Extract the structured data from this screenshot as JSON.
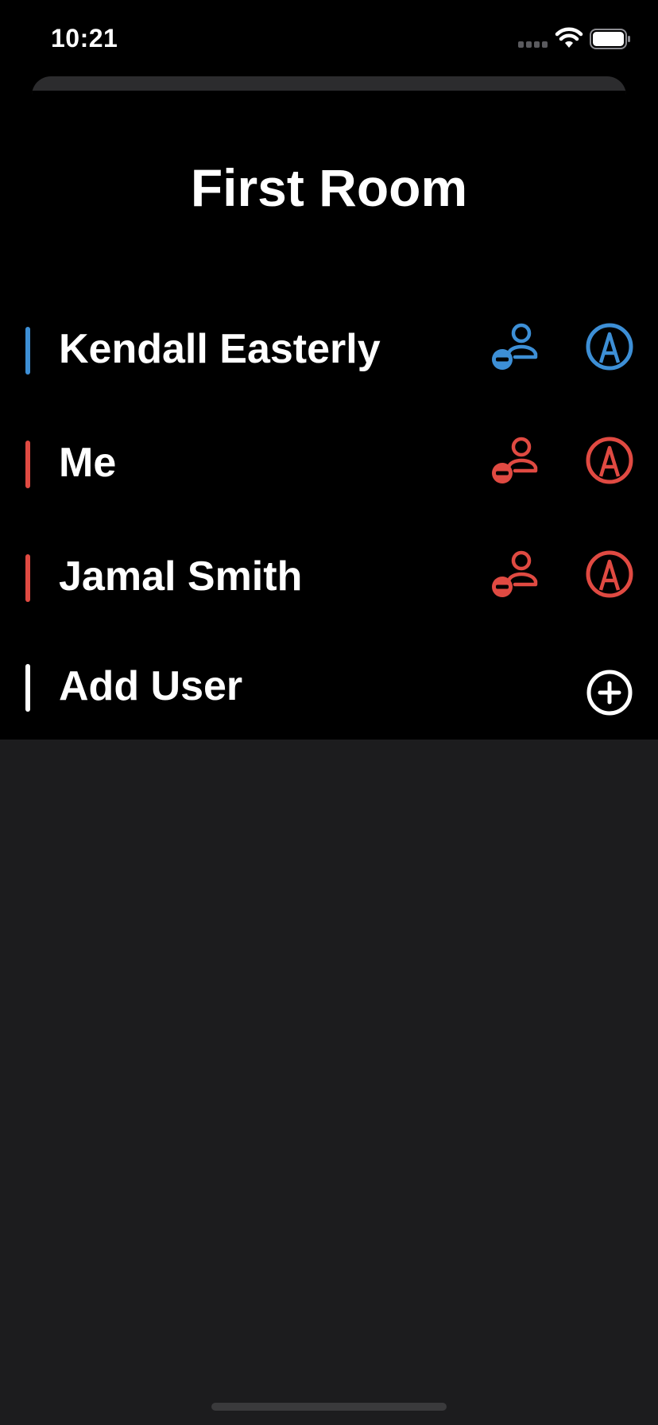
{
  "status_bar": {
    "time": "10:21"
  },
  "page": {
    "title": "First Room"
  },
  "colors": {
    "blue": "#3d8fd6",
    "red": "#e04a42",
    "white": "#ffffff",
    "background": "#000000",
    "lower_background": "#1c1c1e"
  },
  "users": [
    {
      "name": "Kendall Easterly",
      "color": "#3d8fd6",
      "remove_icon": "person-remove-icon",
      "role_icon": "pencil-circle-icon"
    },
    {
      "name": "Me",
      "color": "#e04a42",
      "remove_icon": "person-remove-icon",
      "role_icon": "pencil-circle-icon"
    },
    {
      "name": "Jamal Smith",
      "color": "#e04a42",
      "remove_icon": "person-remove-icon",
      "role_icon": "pencil-circle-icon"
    }
  ],
  "add_user": {
    "label": "Add User",
    "icon": "plus-circle-icon"
  }
}
